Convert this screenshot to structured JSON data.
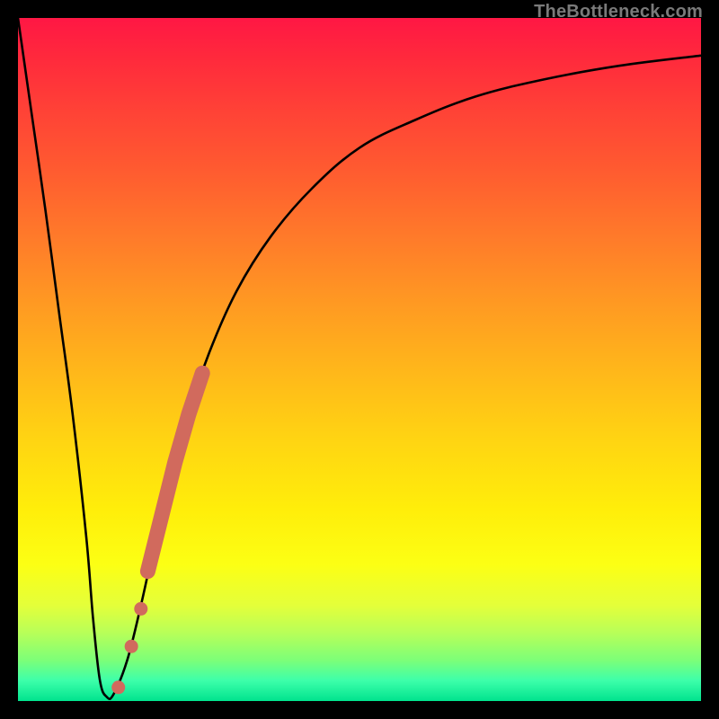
{
  "attribution": "TheBottleneck.com",
  "colors": {
    "border": "#000000",
    "curve": "#000000",
    "dots": "#d16a5d",
    "gradient_top": "#ff1744",
    "gradient_mid1": "#ff9a22",
    "gradient_mid2": "#ffee0a",
    "gradient_bottom": "#00e38e"
  },
  "chart_data": {
    "type": "line",
    "title": "",
    "xlabel": "",
    "ylabel": "",
    "xlim": [
      0,
      100
    ],
    "ylim": [
      0,
      100
    ],
    "grid": false,
    "series": [
      {
        "name": "bottleneck-curve",
        "x": [
          0,
          2,
          4,
          6,
          8,
          10,
          11,
          12,
          13,
          14,
          16,
          18,
          20,
          22,
          25,
          28,
          32,
          37,
          43,
          50,
          58,
          67,
          77,
          88,
          100
        ],
        "y": [
          100,
          86,
          72,
          57,
          42,
          24,
          12,
          3,
          0.6,
          1,
          6,
          14,
          23,
          31,
          42,
          51,
          60,
          68,
          75,
          81,
          85,
          88.5,
          91,
          93,
          94.5
        ]
      }
    ],
    "dots": {
      "name": "highlight-segment",
      "points": [
        {
          "x": 14.7,
          "y": 2.0
        },
        {
          "x": 16.6,
          "y": 8.0
        },
        {
          "x": 18.0,
          "y": 13.5
        },
        {
          "x": 19.0,
          "y": 19.0
        },
        {
          "x": 20.0,
          "y": 23.0
        },
        {
          "x": 21.0,
          "y": 27.0
        },
        {
          "x": 22.0,
          "y": 31.0
        },
        {
          "x": 23.0,
          "y": 35.0
        },
        {
          "x": 24.0,
          "y": 38.5
        },
        {
          "x": 25.0,
          "y": 42.0
        },
        {
          "x": 26.0,
          "y": 45.0
        },
        {
          "x": 27.0,
          "y": 48.0
        }
      ],
      "thick_range": {
        "start_index": 3,
        "end_index": 11
      }
    }
  }
}
